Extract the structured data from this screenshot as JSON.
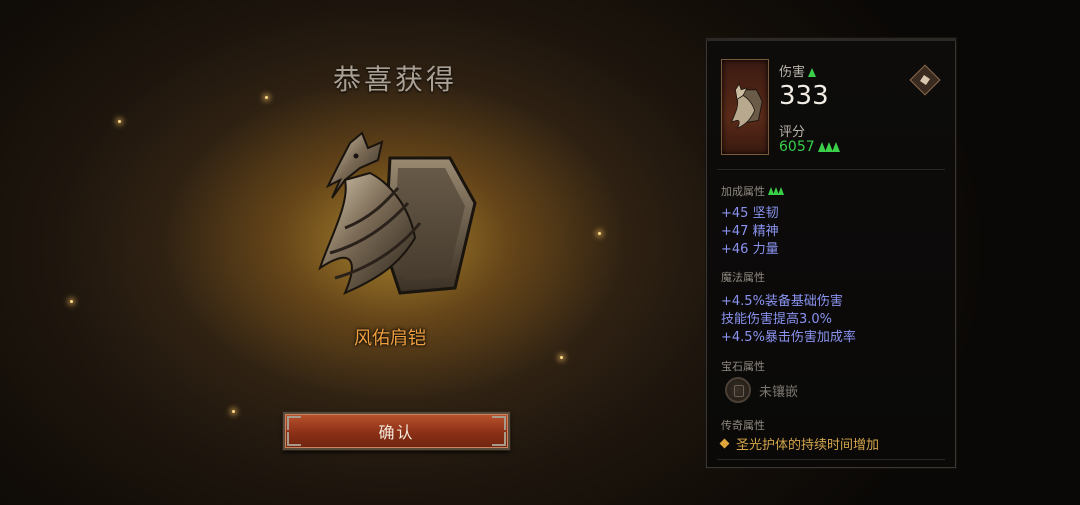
{
  "reward": {
    "title": "恭喜获得",
    "item_name": "风佑肩铠",
    "confirm_label": "确认"
  },
  "item_panel": {
    "damage_label": "伤害",
    "damage_value": "333",
    "score_label": "评分",
    "score_value": "6057",
    "bonus_section": "加成属性",
    "bonus_stats": [
      "+45 坚韧",
      "+47 精神",
      "+46 力量"
    ],
    "magic_section": "魔法属性",
    "magic_stats": [
      "+4.5%装备基础伤害",
      "技能伤害提高3.0%",
      "+4.5%暴击伤害加成率"
    ],
    "gem_section": "宝石属性",
    "gem_value": "未镶嵌",
    "legend_section": "传奇属性",
    "legend_value": "圣光护体的持续时间增加"
  },
  "colors": {
    "stat_blue": "#8a93f0",
    "upgrade_green": "#35d04a",
    "legend_gold": "#d4a64a",
    "item_orange": "#f0a040"
  },
  "icons": [
    "shoulder-armor-icon",
    "upgrade-arrow-icon",
    "compare-diamond-icon",
    "gem-socket-icon",
    "legend-diamond-icon"
  ]
}
